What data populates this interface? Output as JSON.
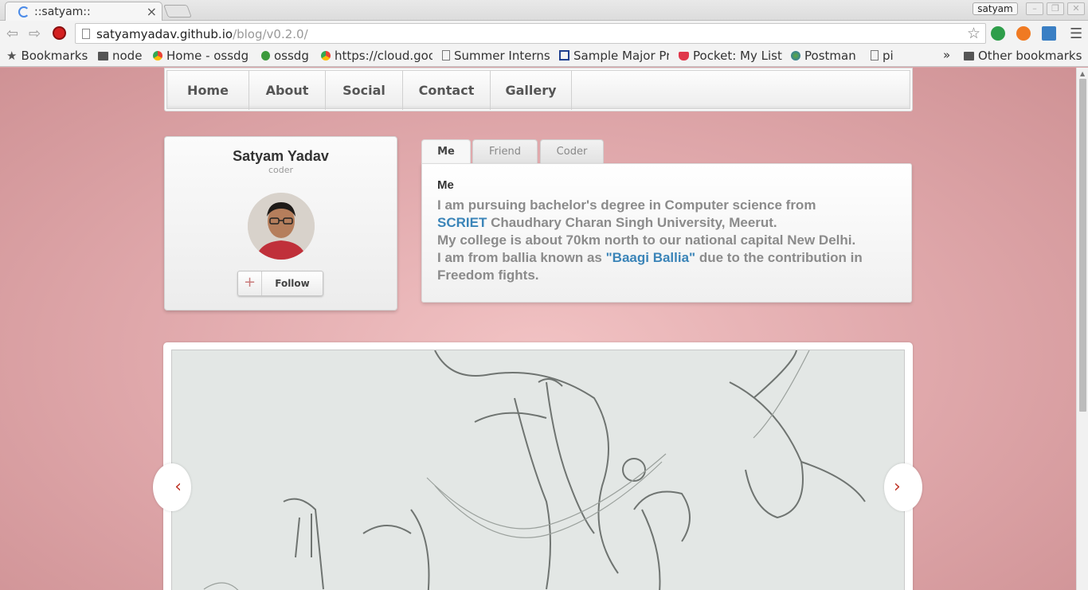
{
  "browser": {
    "tab_title": "::satyam::",
    "tab_close": "×",
    "user_name": "satyam",
    "url_host": "satyamyadav.github.io",
    "url_path": "/blog/v0.2.0/",
    "bookmarks": [
      {
        "label": "Bookmarks",
        "icon": "star-icon"
      },
      {
        "label": "node",
        "icon": "folder-icon"
      },
      {
        "label": "Home - ossdg",
        "icon": "chrome-icon"
      },
      {
        "label": "ossdg",
        "icon": "github-icon"
      },
      {
        "label": "https://cloud.goo",
        "icon": "chrome-icon"
      },
      {
        "label": "Summer Interns",
        "icon": "page-icon"
      },
      {
        "label": "Sample Major Pr",
        "icon": "sheet-icon"
      },
      {
        "label": "Pocket: My List",
        "icon": "pocket-icon"
      },
      {
        "label": "Postman",
        "icon": "globe-icon"
      },
      {
        "label": "pi",
        "icon": "page-icon"
      }
    ],
    "bookmarks_overflow": "»",
    "other_bookmarks": "Other bookmarks"
  },
  "nav": {
    "items": [
      "Home",
      "About",
      "Social",
      "Contact",
      "Gallery"
    ]
  },
  "profile": {
    "name": "Satyam Yadav",
    "role": "coder",
    "follow_label": "Follow",
    "follow_icon": "+"
  },
  "tabs": {
    "items": [
      "Me",
      "Friend",
      "Coder"
    ],
    "active": "Me",
    "panel_heading": "Me",
    "line1": "I am pursuing bachelor's degree in Computer science from",
    "link1": "SCRIET",
    "line2": " Chaudhary Charan Singh University, Meerut.",
    "line3": "My college is about 70km north to our national capital New Delhi.",
    "line4_pre": "I am from ballia known as ",
    "link2": "\"Baagi Ballia\"",
    "line4_post": " due to the contribution in Freedom fights."
  },
  "gallery": {
    "prev": "‹",
    "next": "›"
  },
  "colors": {
    "accent_link": "#3a84b8",
    "carousel_arrow": "#c0392b",
    "page_bg": "#e2abae"
  }
}
